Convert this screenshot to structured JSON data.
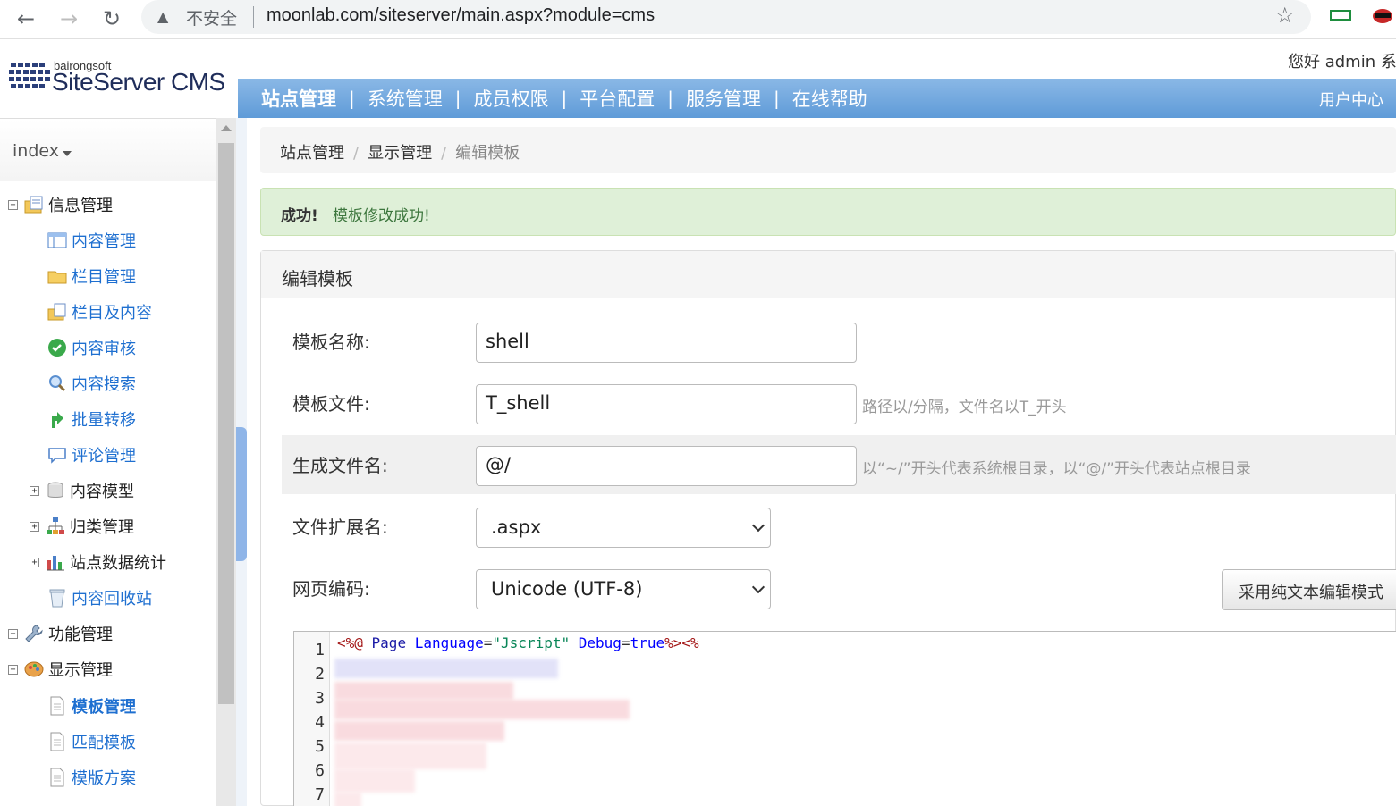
{
  "browser": {
    "security_label": "不安全",
    "url": "moonlab.com/siteserver/main.aspx?module=cms"
  },
  "header": {
    "logo_small": "bairongsoft",
    "logo_big": "SiteServer CMS",
    "greeting": "您好 admin 系",
    "user_center": "用户中心"
  },
  "topnav": {
    "items": [
      {
        "label": "站点管理",
        "active": true
      },
      {
        "label": "系统管理"
      },
      {
        "label": "成员权限"
      },
      {
        "label": "平台配置"
      },
      {
        "label": "服务管理"
      },
      {
        "label": "在线帮助"
      }
    ],
    "separator": "|"
  },
  "sidebar": {
    "site": "index",
    "tree": [
      {
        "label": "信息管理",
        "expander": "−"
      },
      {
        "label": "内容管理"
      },
      {
        "label": "栏目管理"
      },
      {
        "label": "栏目及内容"
      },
      {
        "label": "内容审核"
      },
      {
        "label": "内容搜索"
      },
      {
        "label": "批量转移"
      },
      {
        "label": "评论管理"
      },
      {
        "label": "内容模型",
        "expander": "+"
      },
      {
        "label": "归类管理",
        "expander": "+"
      },
      {
        "label": "站点数据统计",
        "expander": "+"
      },
      {
        "label": "内容回收站"
      },
      {
        "label": "功能管理",
        "expander": "+"
      },
      {
        "label": "显示管理",
        "expander": "−"
      },
      {
        "label": "模板管理"
      },
      {
        "label": "匹配模板"
      },
      {
        "label": "模版方案"
      }
    ]
  },
  "breadcrumb": {
    "items": [
      "站点管理",
      "显示管理",
      "编辑模板"
    ],
    "separator": "/"
  },
  "alert": {
    "strong": "成功!",
    "message": "模板修改成功!"
  },
  "panel": {
    "title": "编辑模板",
    "fields": {
      "name": {
        "label": "模板名称:",
        "value": "shell"
      },
      "file": {
        "label": "模板文件:",
        "value": "T_shell",
        "help": "路径以/分隔，文件名以T_开头"
      },
      "created_file": {
        "label": "生成文件名:",
        "value": "@/",
        "help": "以“~/”开头代表系统根目录，以“@/”开头代表站点根目录"
      },
      "extension": {
        "label": "文件扩展名:",
        "value": ".aspx"
      },
      "encoding": {
        "label": "网页编码:",
        "value": "Unicode (UTF-8)"
      }
    },
    "plain_text_button": "采用纯文本编辑模式"
  },
  "editor": {
    "line_numbers": [
      "1",
      "2",
      "3",
      "4",
      "5",
      "6",
      "7"
    ],
    "line1": {
      "open": "<%@",
      "directive": " Page ",
      "attr1": "Language",
      "eq1": "=",
      "val1": "\"Jscript\"",
      "sp": " ",
      "attr2": "Debug",
      "eq2": "=",
      "val2": "true",
      "close": "%><%"
    }
  },
  "colors": {
    "topnav_bg": "#6fa6dd",
    "alert_bg": "#dff0d8",
    "link": "#1e6fd0"
  }
}
